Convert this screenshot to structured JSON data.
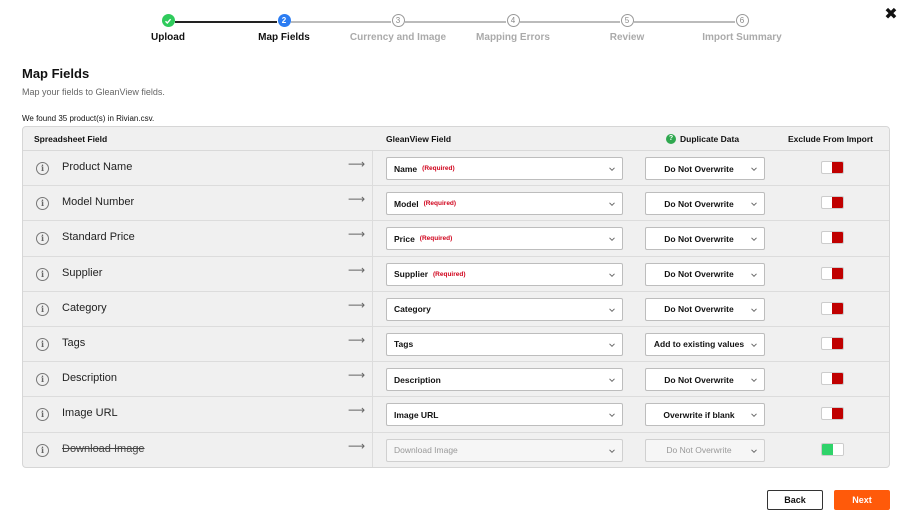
{
  "close_glyph": "✖",
  "stepper": {
    "steps": [
      {
        "label": "Upload",
        "state": "done",
        "number": "1"
      },
      {
        "label": "Map Fields",
        "state": "active",
        "number": "2"
      },
      {
        "label": "Currency and Image",
        "state": "pending",
        "number": "3"
      },
      {
        "label": "Mapping Errors",
        "state": "pending",
        "number": "4"
      },
      {
        "label": "Review",
        "state": "pending",
        "number": "5"
      },
      {
        "label": "Import Summary",
        "state": "pending",
        "number": "6"
      }
    ]
  },
  "header": {
    "title": "Map Fields",
    "subtitle": "Map your fields to GleanView fields.",
    "found_text": "We found 35 product(s) in Rivian.csv."
  },
  "table": {
    "columns": {
      "spreadsheet": "Spreadsheet Field",
      "glean": "GleanView Field",
      "duplicate": "Duplicate Data",
      "exclude": "Exclude From Import",
      "help_glyph": "?"
    },
    "rows": [
      {
        "field": "Product Name",
        "glean": "Name",
        "required": "(Required)",
        "duplicate": "Do Not Overwrite",
        "excluded": false,
        "disabled": false
      },
      {
        "field": "Model Number",
        "glean": "Model",
        "required": "(Required)",
        "duplicate": "Do Not Overwrite",
        "excluded": false,
        "disabled": false
      },
      {
        "field": "Standard Price",
        "glean": "Price",
        "required": "(Required)",
        "duplicate": "Do Not Overwrite",
        "excluded": false,
        "disabled": false
      },
      {
        "field": "Supplier",
        "glean": "Supplier",
        "required": "(Required)",
        "duplicate": "Do Not Overwrite",
        "excluded": false,
        "disabled": false
      },
      {
        "field": "Category",
        "glean": "Category",
        "required": "",
        "duplicate": "Do Not Overwrite",
        "excluded": false,
        "disabled": false
      },
      {
        "field": "Tags",
        "glean": "Tags",
        "required": "",
        "duplicate": "Add to existing values",
        "excluded": false,
        "disabled": false
      },
      {
        "field": "Description",
        "glean": "Description",
        "required": "",
        "duplicate": "Do Not Overwrite",
        "excluded": false,
        "disabled": false
      },
      {
        "field": "Image URL",
        "glean": "Image URL",
        "required": "",
        "duplicate": "Overwrite if blank",
        "excluded": false,
        "disabled": false
      },
      {
        "field": "Download Image",
        "glean": "Download Image",
        "required": "",
        "duplicate": "Do Not Overwrite",
        "excluded": true,
        "disabled": true
      }
    ]
  },
  "footer": {
    "back_label": "Back",
    "next_label": "Next"
  },
  "colors": {
    "accent": "#ff5a0a",
    "active_step": "#2b7cf2",
    "done_step": "#2fcb5c",
    "required": "#d0021b",
    "toggle_off": "#c00000",
    "toggle_on": "#2fd36a"
  }
}
